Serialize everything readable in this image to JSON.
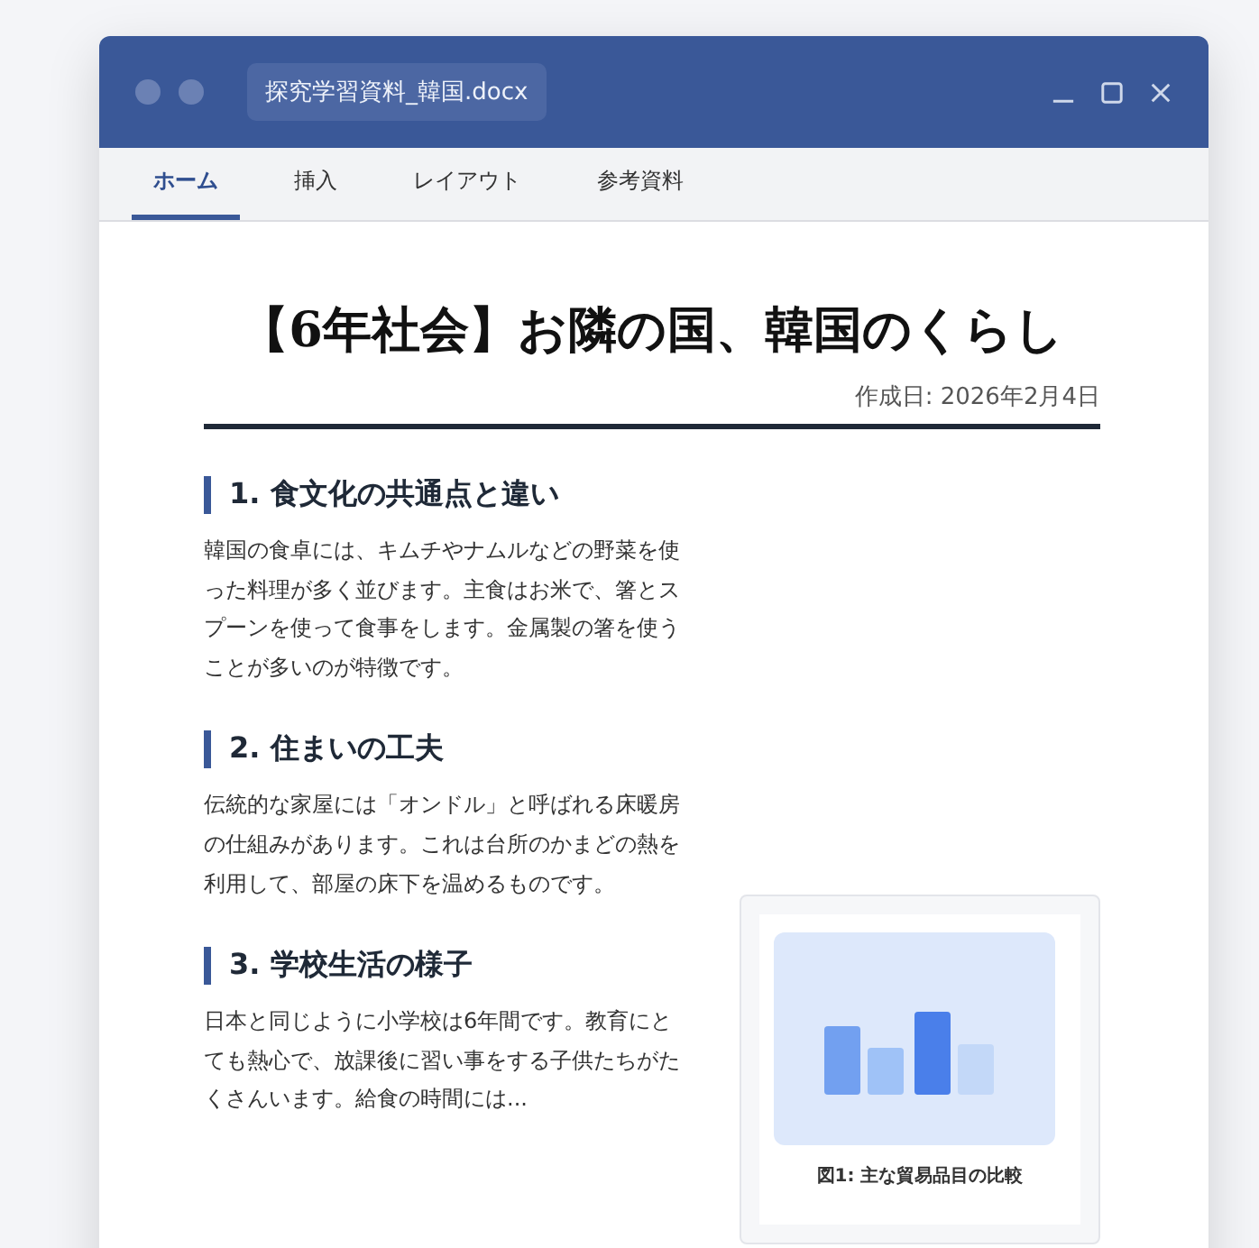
{
  "window": {
    "title": "探究学習資料_韓国.docx"
  },
  "tabs": [
    {
      "label": "ホーム",
      "selected": true
    },
    {
      "label": "挿入",
      "selected": false
    },
    {
      "label": "レイアウト",
      "selected": false
    },
    {
      "label": "参考資料",
      "selected": false
    }
  ],
  "document": {
    "title": "【6年社会】お隣の国、韓国のくらし",
    "date": "作成日: 2026年2月4日",
    "sections": [
      {
        "heading": "1. 食文化の共通点と違い",
        "body": "韓国の食卓には、キムチやナムルなどの野菜を使った料理が多く並びます。主食はお米で、箸とスプーンを使って食事をします。金属製の箸を使うことが多いのが特徴です。"
      },
      {
        "heading": "2. 住まいの工夫",
        "body": "伝統的な家屋には「オンドル」と呼ばれる床暖房の仕組みがあります。これは台所のかまどの熱を利用して、部屋の床下を温めるものです。"
      },
      {
        "heading": "3. 学校生活の様子",
        "body": "日本と同じように小学校は6年間です。教育にとても熱心で、放課後に習い事をする子供たちがたくさんいます。給食の時間には..."
      }
    ],
    "figure": {
      "caption": "図1: 主な貿易品目の比較"
    }
  }
}
